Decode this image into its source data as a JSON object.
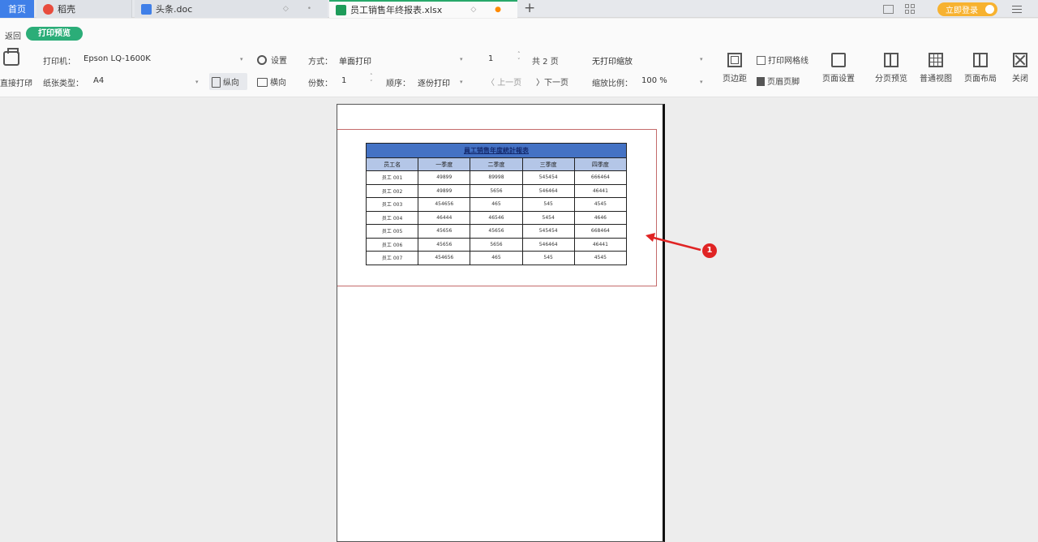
{
  "tabs": [
    {
      "label": "首页",
      "active": false
    },
    {
      "label": "稻壳",
      "active": false
    },
    {
      "label": "头条.doc",
      "active": false
    },
    {
      "label": "员工销售年终报表.xlsx",
      "active": true,
      "unsaved": true
    }
  ],
  "top_right": {
    "login_label": "立即登录"
  },
  "toolbar": {
    "back_label": "返回",
    "print_preview_label": "打印预览",
    "direct_print_label": "直接打印",
    "printer_label": "打印机：",
    "printer_value": "Epson LQ-1600K",
    "settings_label": "设置",
    "mode_label": "方式：",
    "mode_value": "单面打印",
    "page_current": "1",
    "page_total_label": "共 2 页",
    "no_print_scale_value": "无打印缩放",
    "print_gridlines_label": "打印网格线",
    "paper_type_label": "纸张类型：",
    "paper_type_value": "A4",
    "portrait_label": "纵向",
    "landscape_label": "横向",
    "copies_label": "份数：",
    "copies_value": "1",
    "order_label": "顺序：",
    "order_value": "逐份打印",
    "prev_page_label": "上一页",
    "next_page_label": "下一页",
    "zoom_label": "缩放比例：",
    "zoom_value": "100 %",
    "header_footer_label": "页眉页脚",
    "buttons": {
      "margins": "页边距",
      "page_setup": "页面设置",
      "page_break_preview": "分页预览",
      "normal_view": "普通视图",
      "page_layout": "页面布局",
      "close": "关闭"
    }
  },
  "sheet": {
    "title": "員工销售年度統計報表",
    "headers": [
      "员工名",
      "一季度",
      "二季度",
      "三季度",
      "四季度"
    ],
    "rows": [
      [
        "员工 001",
        "49899",
        "89998",
        "545454",
        "666464"
      ],
      [
        "员工 002",
        "49899",
        "5656",
        "546464",
        "46441"
      ],
      [
        "员工 003",
        "454656",
        "465",
        "545",
        "4545"
      ],
      [
        "员工 004",
        "46444",
        "46546",
        "5454",
        "4646"
      ],
      [
        "员工 005",
        "45656",
        "45656",
        "545454",
        "668464"
      ],
      [
        "员工 006",
        "45656",
        "5656",
        "546464",
        "46441"
      ],
      [
        "员工 007",
        "454656",
        "465",
        "545",
        "4545"
      ]
    ]
  },
  "annotation": {
    "badge": "1"
  },
  "colors": {
    "accent_green": "#2bad78",
    "tab_home_blue": "#3f7fe8",
    "annotation_red": "#e02424",
    "table_title_blue": "#4472c4",
    "table_header_blue": "#b4c6e7"
  }
}
